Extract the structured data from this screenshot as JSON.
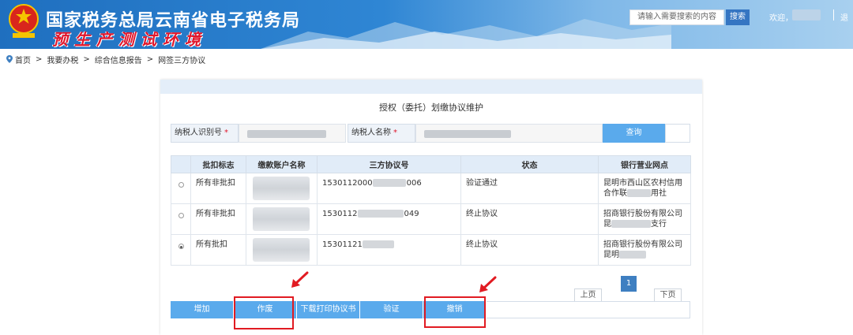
{
  "header": {
    "title": "国家税务总局云南省电子税务局",
    "subtitle": "预生产测试环境",
    "search_placeholder": "请输入需要搜索的内容",
    "search_button": "搜索",
    "welcome": "欢迎，",
    "logout_partial": "退"
  },
  "breadcrumb": {
    "items": [
      "首页",
      "我要办税",
      "综合信息报告",
      "网签三方协议"
    ],
    "separator": ">"
  },
  "panel": {
    "title": "授权（委托）划缴协议维护",
    "taxpayer_id_label": "纳税人识别号",
    "taxpayer_name_label": "纳税人名称",
    "required_mark": "*",
    "query_button": "查询"
  },
  "table": {
    "headers": [
      "",
      "批扣标志",
      "缴款账户名称",
      "三方协议号",
      "状态",
      "银行营业网点"
    ],
    "rows": [
      {
        "selected": false,
        "flag": "所有非批扣",
        "protocol_prefix": "1530112000",
        "protocol_suffix": "006",
        "status": "验证通过",
        "bank_line1": "昆明市西山区农村信用",
        "bank_line2_prefix": "合作联",
        "bank_line2_suffix": "用社"
      },
      {
        "selected": false,
        "flag": "所有非批扣",
        "protocol_prefix": "1530112",
        "protocol_suffix": "049",
        "status": "终止协议",
        "bank_line1": "招商银行股份有限公司",
        "bank_line2_prefix": "昆",
        "bank_line2_suffix": "支行"
      },
      {
        "selected": true,
        "flag": "所有批扣",
        "protocol_prefix": "15301121",
        "protocol_suffix": "",
        "status": "终止协议",
        "bank_line1": "招商银行股份有限公司",
        "bank_line2_prefix": "昆明",
        "bank_line2_suffix": ""
      }
    ]
  },
  "pagination": {
    "current_page": "1",
    "prev": "上页",
    "next": "下页"
  },
  "actions": {
    "add": "增加",
    "void": "作废",
    "download": "下载打印协议书",
    "verify": "验证",
    "revoke": "撤销"
  },
  "colors": {
    "header_blue": "#2f86d4",
    "button_blue": "#5aaaec",
    "annotation_red": "#e11b22",
    "required_red": "#e0162b"
  }
}
